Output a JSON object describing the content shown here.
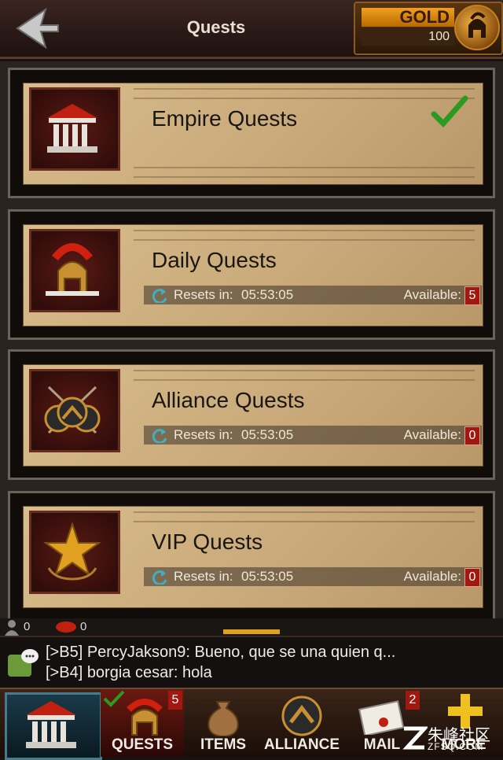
{
  "header": {
    "title": "Quests",
    "gold_label": "GOLD",
    "gold_value": "100"
  },
  "quests": [
    {
      "name": "Empire Quests",
      "icon": "temple-icon",
      "completed": true
    },
    {
      "name": "Daily Quests",
      "icon": "spartan-helmet-icon",
      "reset_label": "Resets in:",
      "reset_time": "05:53:05",
      "available_label": "Available:",
      "available_count": "5"
    },
    {
      "name": "Alliance Quests",
      "icon": "crossed-spears-shields-icon",
      "reset_label": "Resets in:",
      "reset_time": "05:53:05",
      "available_label": "Available:",
      "available_count": "0"
    },
    {
      "name": "VIP Quests",
      "icon": "gold-star-icon",
      "reset_label": "Resets in:",
      "reset_time": "05:53:05",
      "available_label": "Available:",
      "available_count": "0"
    }
  ],
  "status": {
    "players_online": "0",
    "messages": "0"
  },
  "chat": {
    "lines": [
      "[>B5] PercyJakson9: Bueno, que se una quien q...",
      "[>B4] borgia cesar: hola"
    ]
  },
  "nav": {
    "items": [
      {
        "label": "QUESTS",
        "badge": "5"
      },
      {
        "label": "ITEMS"
      },
      {
        "label": "ALLIANCE"
      },
      {
        "label": "MAIL",
        "badge": "2"
      },
      {
        "label": "MORE"
      }
    ]
  },
  "watermark": {
    "text_cn": "朱峰社区",
    "text_en": "ZFSQ.COM"
  },
  "colors": {
    "accent_gold": "#f0a020",
    "badge_red": "#a01810",
    "parchment": "#c8a878"
  }
}
